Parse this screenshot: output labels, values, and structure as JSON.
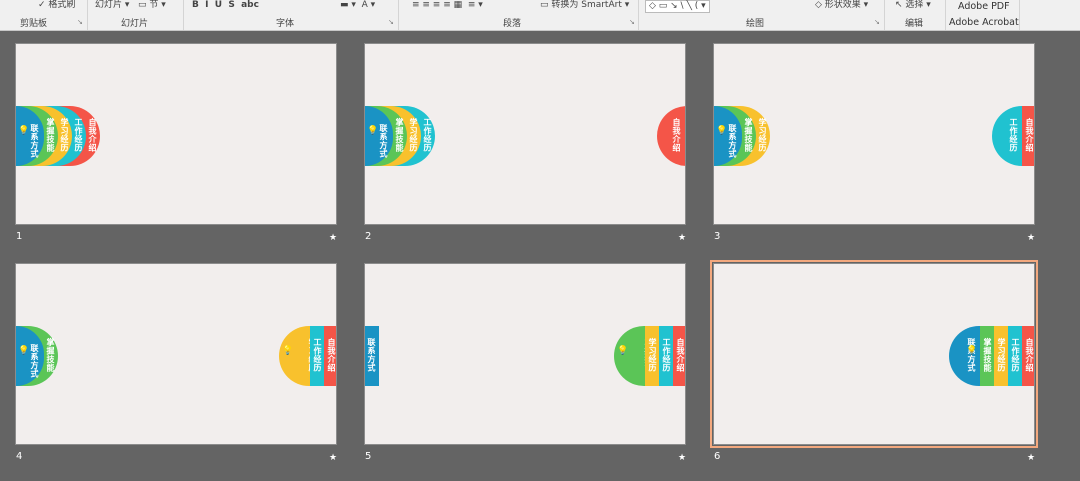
{
  "ribbon": {
    "format_painter": "格式刷",
    "new_slide": "幻灯片",
    "section": "节",
    "convert_smartart": "转换为 SmartArt",
    "shape_effects": "形状效果",
    "select": "选择",
    "adobe_pdf": "Adobe PDF",
    "groups": {
      "clipboard": "剪贴板",
      "slides": "幻灯片",
      "font": "字体",
      "paragraph": "段落",
      "drawing": "绘图",
      "editing": "编辑",
      "acrobat": "Adobe Acrobat"
    }
  },
  "tabs": {
    "contact": "联系方式",
    "skills": "掌握技能",
    "study": "学习经历",
    "work": "工作经历",
    "intro": "自我介绍"
  },
  "colors": {
    "contact": "#1a93c4",
    "skills": "#5bc557",
    "study": "#f8c12d",
    "work": "#20c2d0",
    "intro": "#f45548",
    "selection": "#f4a97f"
  },
  "slides": [
    {
      "number": "1",
      "star": "★"
    },
    {
      "number": "2",
      "star": "★"
    },
    {
      "number": "3",
      "star": "★"
    },
    {
      "number": "4",
      "star": "★"
    },
    {
      "number": "5",
      "star": "★"
    },
    {
      "number": "6",
      "star": "★"
    }
  ]
}
